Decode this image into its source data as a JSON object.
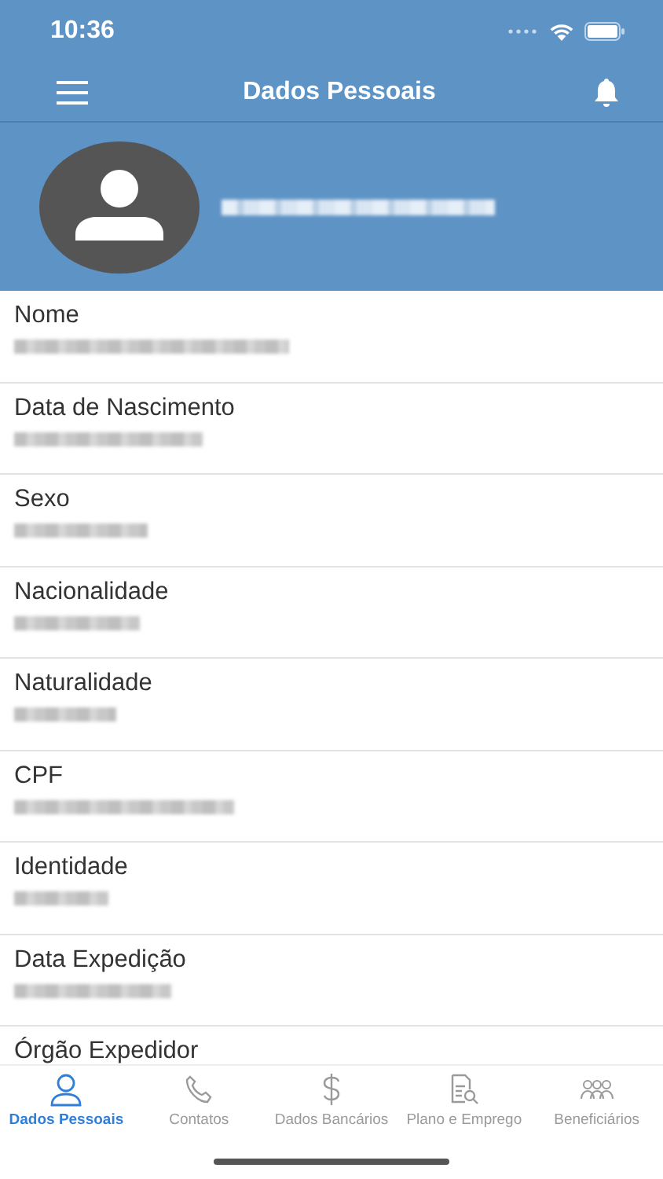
{
  "status_bar": {
    "time": "10:36"
  },
  "nav": {
    "title": "Dados Pessoais"
  },
  "fields": [
    {
      "label": "Nome"
    },
    {
      "label": "Data de Nascimento"
    },
    {
      "label": "Sexo"
    },
    {
      "label": "Nacionalidade"
    },
    {
      "label": "Naturalidade"
    },
    {
      "label": "CPF"
    },
    {
      "label": "Identidade"
    },
    {
      "label": "Data Expedição"
    },
    {
      "label": "Órgão Expedidor"
    }
  ],
  "tabs": [
    {
      "label": "Dados Pessoais",
      "kind": "person",
      "selected": true
    },
    {
      "label": "Contatos",
      "kind": "phone",
      "selected": false
    },
    {
      "label": "Dados Bancários",
      "kind": "dollar",
      "selected": false
    },
    {
      "label": "Plano e Emprego",
      "kind": "document",
      "selected": false
    },
    {
      "label": "Beneficiários",
      "kind": "group",
      "selected": false
    }
  ]
}
